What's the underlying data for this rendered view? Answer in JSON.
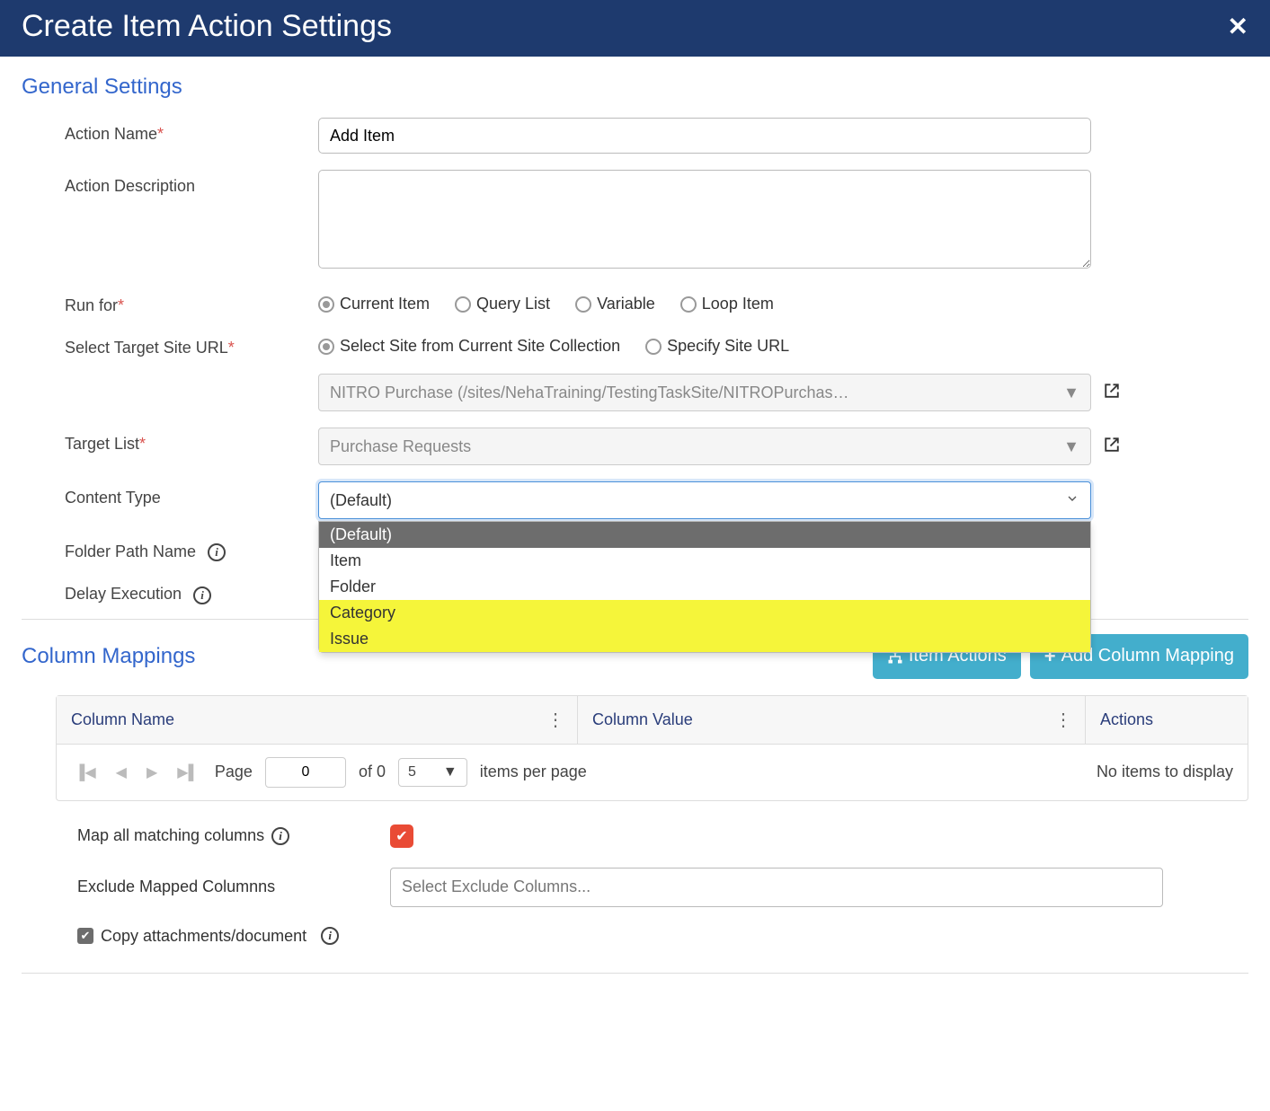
{
  "header": {
    "title": "Create Item Action Settings"
  },
  "general": {
    "section_title": "General Settings",
    "action_name_label": "Action Name",
    "action_name_value": "Add Item",
    "action_desc_label": "Action Description",
    "action_desc_value": "",
    "run_for_label": "Run for",
    "run_for_options": {
      "current_item": "Current Item",
      "query_list": "Query List",
      "variable": "Variable",
      "loop_item": "Loop Item"
    },
    "site_url_label": "Select Target Site URL",
    "site_url_options": {
      "select_collection": "Select Site from Current Site Collection",
      "specify": "Specify Site URL"
    },
    "site_dropdown_value": "NITRO Purchase (/sites/NehaTraining/TestingTaskSite/NITROPurchas…",
    "target_list_label": "Target List",
    "target_list_value": "Purchase Requests",
    "content_type_label": "Content Type",
    "content_type_value": "(Default)",
    "content_type_options": {
      "default": "(Default)",
      "item": "Item",
      "folder": "Folder",
      "category": "Category",
      "issue": "Issue"
    },
    "folder_path_label": "Folder Path Name",
    "delay_exec_label": "Delay Execution"
  },
  "mappings": {
    "section_title": "Column Mappings",
    "item_actions_btn": "Item Actions",
    "add_mapping_btn": "Add Column Mapping",
    "col_name_header": "Column Name",
    "col_value_header": "Column Value",
    "col_actions_header": "Actions",
    "page_label": "Page",
    "page_value": "0",
    "of_label": "of 0",
    "pagesize_value": "5",
    "per_page_label": "items per page",
    "no_items": "No items to display",
    "map_all_label": "Map all matching columns",
    "exclude_label": "Exclude Mapped Columnns",
    "exclude_placeholder": "Select Exclude Columns...",
    "copy_attach_label": "Copy attachments/document"
  }
}
